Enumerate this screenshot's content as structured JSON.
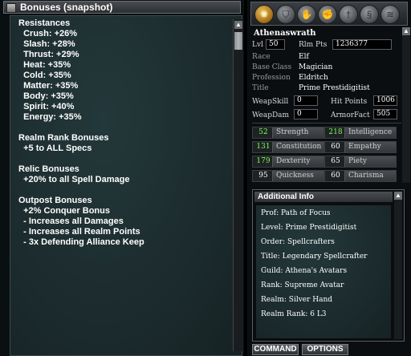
{
  "bonuses_window": {
    "title": "Bonuses (snapshot)",
    "lines": [
      "Resistances",
      "  Crush: +26%",
      "  Slash: +28%",
      "  Thrust: +29%",
      "  Heat: +35%",
      "  Cold: +35%",
      "  Matter: +35%",
      "  Body: +35%",
      "  Spirit: +40%",
      "  Energy: +35%",
      "",
      "Realm Rank Bonuses",
      "  +5 to ALL Specs",
      "",
      "Relic Bonuses",
      "  +20% to all Spell Damage",
      "",
      "Outpost Bonuses",
      "  +2% Conquer Bonus",
      "  - Increases all Damages",
      "  - Increases all Realm Points",
      "  - 3x Defending Alliance Keep"
    ]
  },
  "character": {
    "tabs": [
      "sun-icon",
      "shield-icon",
      "hand-icon",
      "fist-icon",
      "sword-icon",
      "swirl-icon",
      "scroll-icon"
    ],
    "name": "Athenaswrath",
    "lvl_label": "Lvl",
    "lvl": "50",
    "rlm_pts_label": "Rlm Pts",
    "rlm_pts": "1236377",
    "race_label": "Race",
    "race": "Elf",
    "base_class_label": "Base Class",
    "base_class": "Magician",
    "profession_label": "Profession",
    "profession": "Eldritch",
    "title_label": "Title",
    "title": "Prime Prestidigitist",
    "weapskill_label": "WeapSkill",
    "weapskill": "0",
    "hit_points_label": "Hit Points",
    "hit_points": "1006",
    "weapdam_label": "WeapDam",
    "weapdam": "0",
    "armorfact_label": "ArmorFact",
    "armorfact": "505"
  },
  "stats": [
    {
      "value": "52",
      "name": "Strength",
      "green": true
    },
    {
      "value": "218",
      "name": "Intelligence",
      "green": true
    },
    {
      "value": "131",
      "name": "Constitution",
      "green": true
    },
    {
      "value": "60",
      "name": "Empathy",
      "green": false
    },
    {
      "value": "179",
      "name": "Dexterity",
      "green": true
    },
    {
      "value": "65",
      "name": "Piety",
      "green": false
    },
    {
      "value": "95",
      "name": "Quickness",
      "green": false
    },
    {
      "value": "60",
      "name": "Charisma",
      "green": false
    }
  ],
  "additional_info": {
    "header": "Additional Info",
    "lines": [
      "Prof: Path of Focus",
      "Level: Prime Prestidigitist",
      "Order: Spellcrafters",
      "Title: Legendary Spellcrafter",
      "Guild: Athena's Avatars",
      "Rank: Supreme Avatar",
      "Realm: Silver Hand",
      "Realm Rank: 6 L3"
    ]
  },
  "buttons": {
    "command": "COMMAND",
    "options": "OPTIONS"
  },
  "colors": {
    "stat_green": "#7cff5a",
    "panel_teal": "#1c2b2d"
  }
}
